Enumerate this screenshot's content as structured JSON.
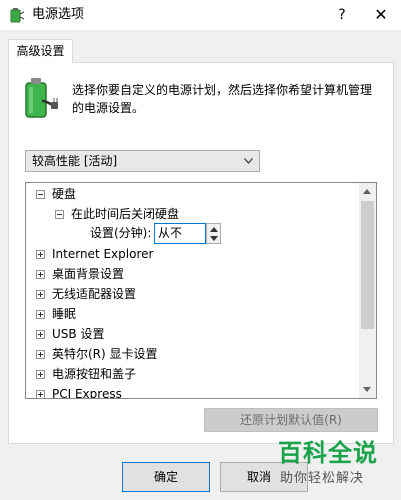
{
  "window": {
    "title": "电源选项",
    "help_glyph": "?",
    "close_glyph": "✕"
  },
  "tab": {
    "label": "高级设置"
  },
  "description": "选择你要自定义的电源计划，然后选择你希望计算机管理的电源设置。",
  "plan_dropdown": {
    "selected": "较高性能 [活动]"
  },
  "tree": {
    "items": [
      {
        "label": "硬盘",
        "expanded": true
      },
      {
        "label": "在此时间后关闭硬盘",
        "expanded": true
      },
      {
        "label": "Internet Explorer"
      },
      {
        "label": "桌面背景设置"
      },
      {
        "label": "无线适配器设置"
      },
      {
        "label": "睡眠"
      },
      {
        "label": "USB 设置"
      },
      {
        "label": "英特尔(R) 显卡设置"
      },
      {
        "label": "电源按钮和盖子"
      },
      {
        "label": "PCI Express"
      }
    ],
    "setting": {
      "label": "设置(分钟):",
      "value": "从不"
    }
  },
  "buttons": {
    "restore_defaults": "还原计划默认值(R)",
    "ok": "确定",
    "cancel": "取消"
  },
  "watermark": {
    "title": "百科全说",
    "subtitle": "助你轻松解决"
  },
  "colors": {
    "accent": "#0078d7",
    "watermark_green": "#1aa34a"
  }
}
